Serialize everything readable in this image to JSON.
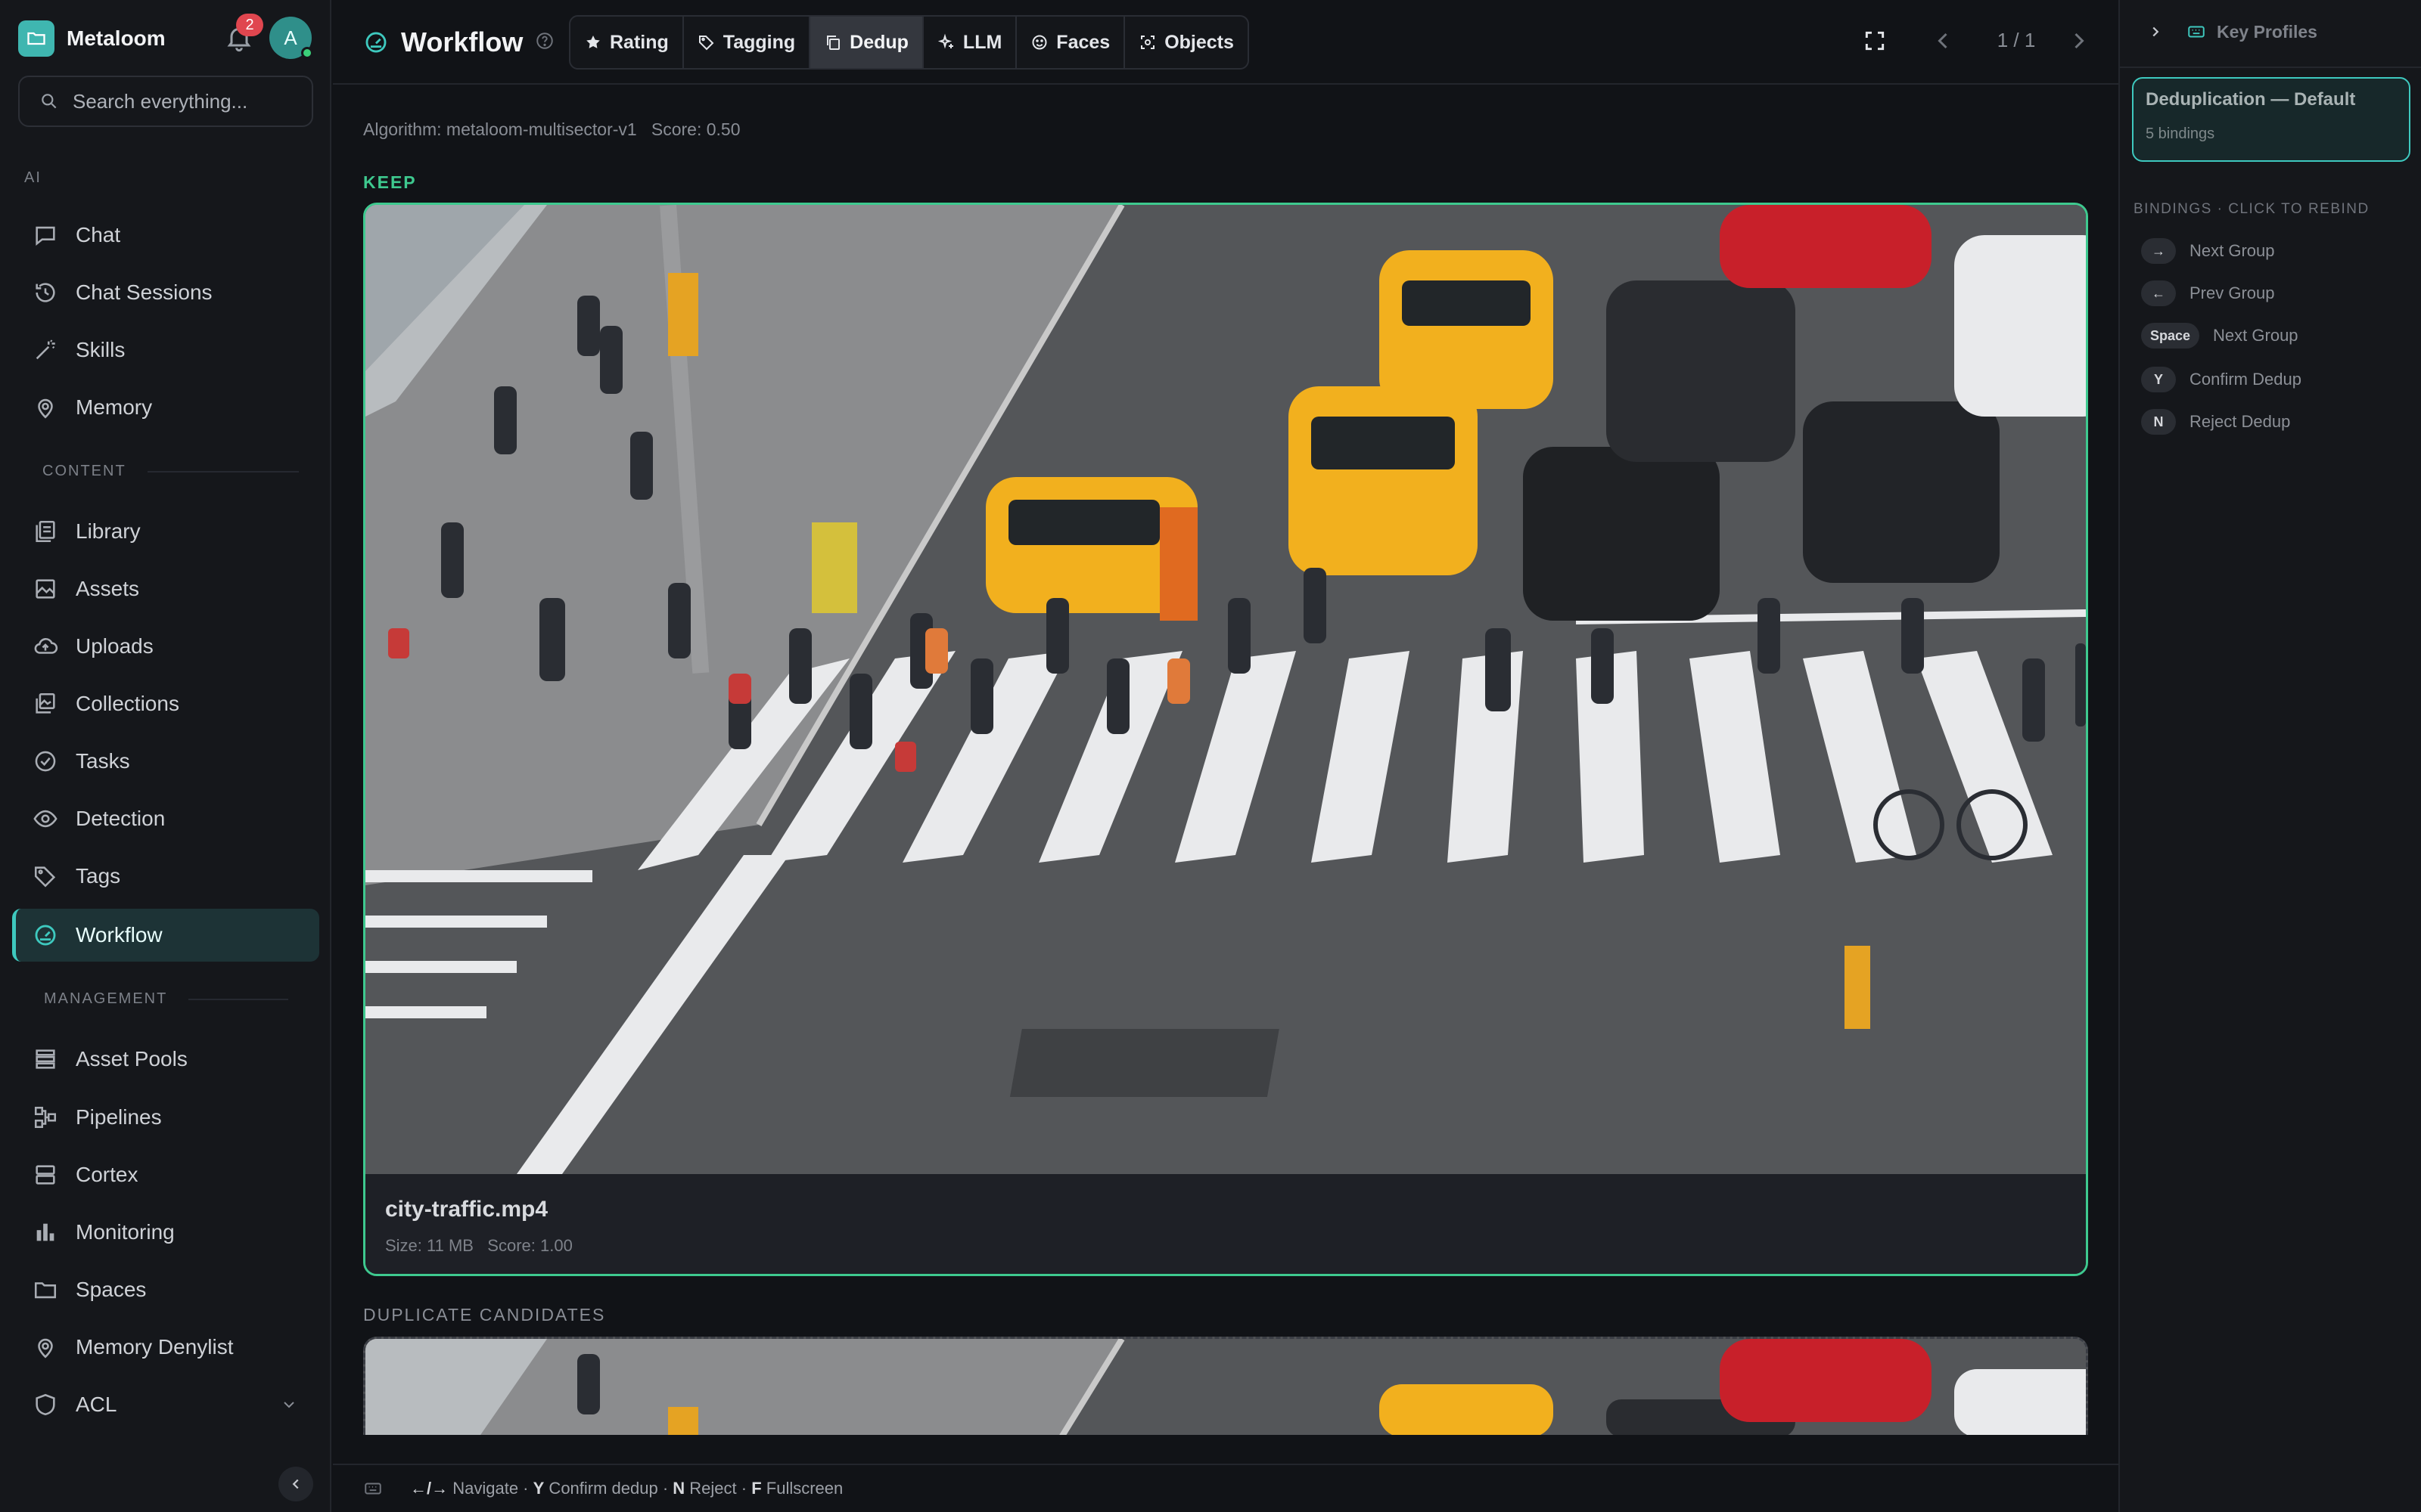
{
  "app": {
    "name": "Metaloom",
    "notifications": "2",
    "avatar_initial": "A"
  },
  "search": {
    "placeholder": "Search everything..."
  },
  "sidebar": {
    "sections": {
      "ai": "AI",
      "content": "CONTENT",
      "management": "MANAGEMENT"
    },
    "items": [
      {
        "label": "Chat",
        "icon": "chat-icon"
      },
      {
        "label": "Chat Sessions",
        "icon": "history-icon"
      },
      {
        "label": "Skills",
        "icon": "wand-icon"
      },
      {
        "label": "Memory",
        "icon": "brain-icon"
      },
      {
        "label": "Library",
        "icon": "library-icon"
      },
      {
        "label": "Assets",
        "icon": "image-icon"
      },
      {
        "label": "Uploads",
        "icon": "cloud-upload-icon"
      },
      {
        "label": "Collections",
        "icon": "collection-icon"
      },
      {
        "label": "Tasks",
        "icon": "check-circle-icon"
      },
      {
        "label": "Detection",
        "icon": "eye-icon"
      },
      {
        "label": "Tags",
        "icon": "tag-icon"
      },
      {
        "label": "Workflow",
        "icon": "gauge-icon",
        "active": true
      },
      {
        "label": "Asset Pools",
        "icon": "stack-icon"
      },
      {
        "label": "Pipelines",
        "icon": "pipeline-icon"
      },
      {
        "label": "Cortex",
        "icon": "server-icon"
      },
      {
        "label": "Monitoring",
        "icon": "bar-chart-icon"
      },
      {
        "label": "Spaces",
        "icon": "folder-icon"
      },
      {
        "label": "Memory Denylist",
        "icon": "brain-icon"
      },
      {
        "label": "ACL",
        "icon": "shield-icon"
      }
    ]
  },
  "header": {
    "title": "Workflow",
    "tabs": [
      {
        "label": "Rating",
        "icon": "star-icon"
      },
      {
        "label": "Tagging",
        "icon": "tag-icon"
      },
      {
        "label": "Dedup",
        "icon": "copy-icon",
        "active": true
      },
      {
        "label": "LLM",
        "icon": "sparkle-icon"
      },
      {
        "label": "Faces",
        "icon": "face-icon"
      },
      {
        "label": "Objects",
        "icon": "scan-icon"
      }
    ],
    "pager": "1 / 1"
  },
  "main": {
    "algorithm": "Algorithm: metaloom-multisector-v1   Score: 0.50",
    "keep_label": "KEEP",
    "keep": {
      "file": "city-traffic.mp4",
      "meta": "Size: 11 MB   Score: 1.00"
    },
    "duplicates_label": "DUPLICATE CANDIDATES"
  },
  "footer": {
    "parts": [
      {
        "key": "←/→",
        "text": " Navigate · "
      },
      {
        "key": "Y",
        "text": " Confirm dedup · "
      },
      {
        "key": "N",
        "text": " Reject · "
      },
      {
        "key": "F",
        "text": " Fullscreen"
      }
    ]
  },
  "right_panel": {
    "title": "Key Profiles",
    "profile": {
      "name": "Deduplication — Default",
      "bindings": "5 bindings"
    },
    "bindings_label": "BINDINGS · CLICK TO REBIND",
    "bindings": [
      {
        "key": "→",
        "action": "Next Group"
      },
      {
        "key": "←",
        "action": "Prev Group"
      },
      {
        "key": "Space",
        "action": "Next Group"
      },
      {
        "key": "Y",
        "action": "Confirm Dedup"
      },
      {
        "key": "N",
        "action": "Reject Dedup"
      }
    ]
  },
  "colors": {
    "accent": "#3ec9bf",
    "keep": "#3ec98f",
    "danger": "#e0464f"
  }
}
